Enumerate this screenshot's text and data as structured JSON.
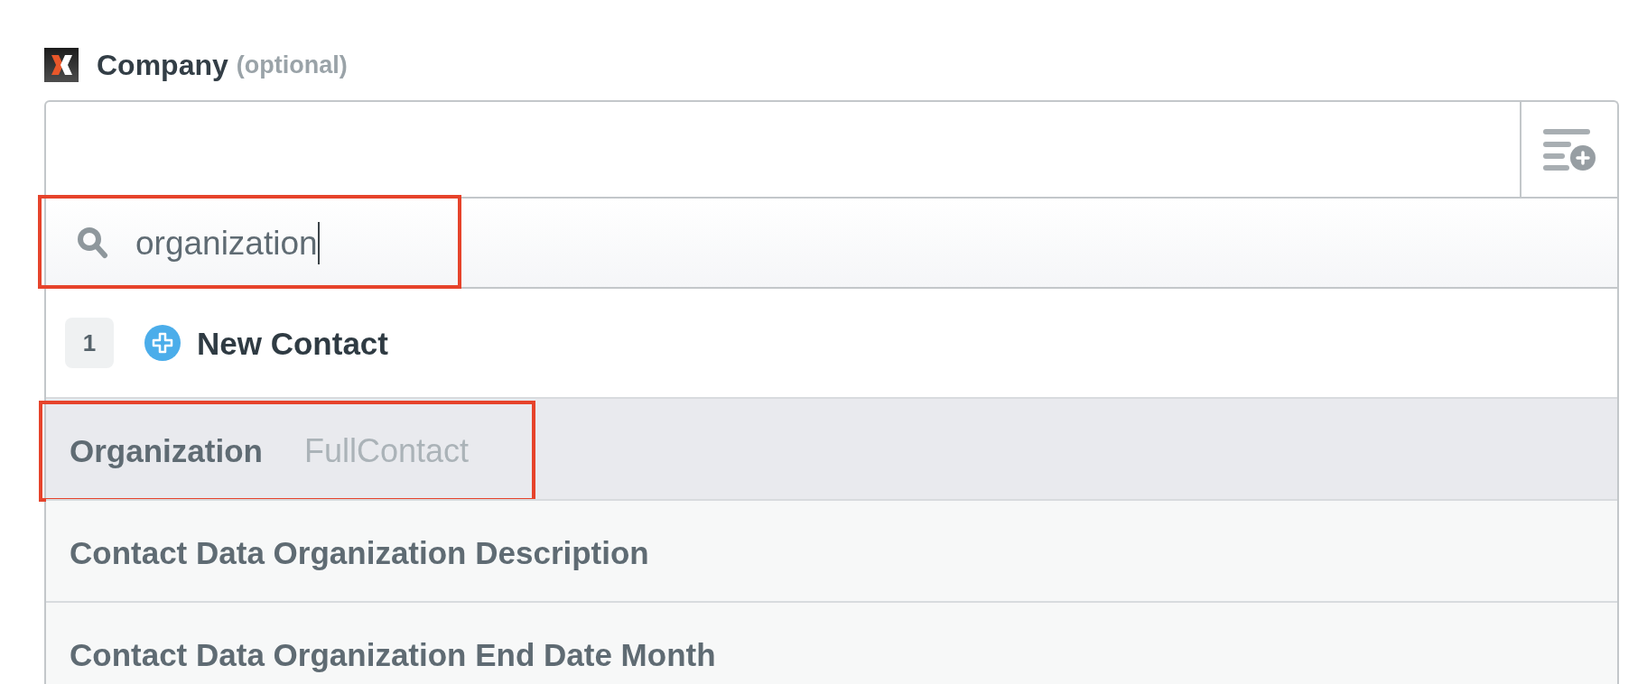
{
  "field": {
    "label": "Company",
    "note": "(optional)"
  },
  "search": {
    "value": "organization",
    "highlighted": true
  },
  "step": {
    "number": "1",
    "title": "New Contact"
  },
  "options": [
    {
      "label": "Organization",
      "source": "FullContact",
      "selected": true,
      "highlighted": true
    },
    {
      "label": "Contact Data Organization Description",
      "selected": false,
      "highlighted": false
    },
    {
      "label": "Contact Data Organization End Date Month",
      "selected": false,
      "highlighted": false
    }
  ]
}
